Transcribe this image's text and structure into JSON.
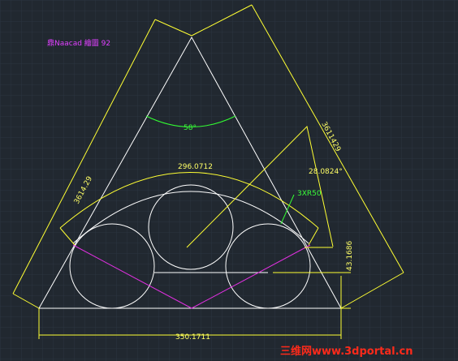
{
  "drawing": {
    "note_text": "鼎Naacad 繪圖 92",
    "dimensions": {
      "left_side": "3614.29",
      "right_side": "3611429",
      "apex_angle": "58°",
      "arc_length": "296.0712",
      "arc_angle": "28.0824°",
      "radius": "3XR50",
      "height": "43.1686",
      "base": "350.1711"
    },
    "watermark": "三维网www.3dportal.cn"
  },
  "colors": {
    "background": "#212830",
    "grid": "#2c3540",
    "geometry": "#ffffff",
    "dimension": "#ffff33",
    "angle": "#33ff33",
    "construction": "#e030e0",
    "watermark": "#ff2a1a"
  }
}
